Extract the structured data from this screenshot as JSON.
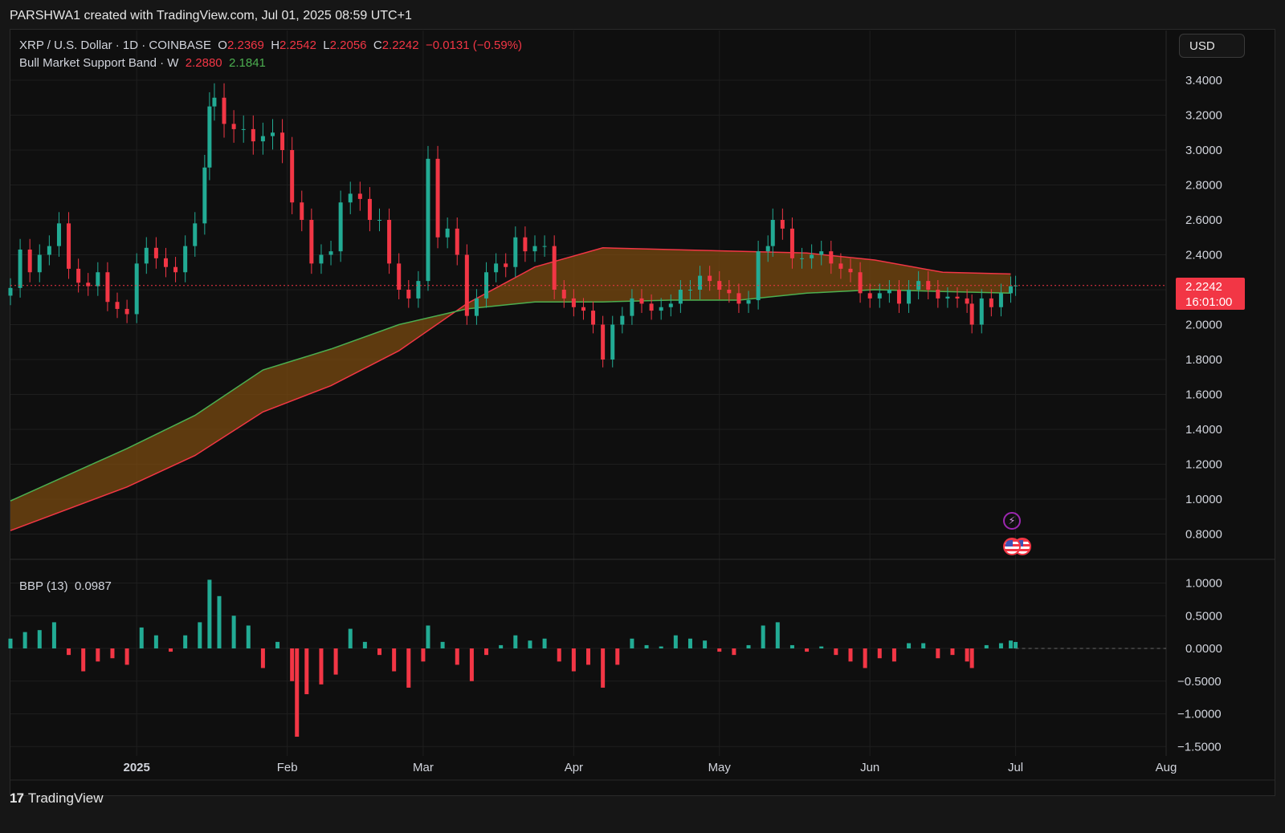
{
  "header": {
    "credit": "PARSHWA1 created with TradingView.com, Jul 01, 2025 08:59 UTC+1"
  },
  "legend": {
    "symbol": "XRP / U.S. Dollar · 1D · COINBASE",
    "o_label": "O",
    "o_value": "2.2369",
    "h_label": "H",
    "h_value": "2.2542",
    "l_label": "L",
    "l_value": "2.2056",
    "c_label": "C",
    "c_value": "2.2242",
    "change": "−0.0131 (−0.59%)",
    "band_name": "Bull Market Support Band · W",
    "band_upper": "2.2880",
    "band_lower": "2.1841"
  },
  "bbp_legend": {
    "name": "BBP (13)",
    "value": "0.0987"
  },
  "currency_button": "USD",
  "price_tag": {
    "price": "2.2242",
    "countdown": "16:01:00"
  },
  "footer": {
    "brand": "TradingView"
  },
  "colors": {
    "up": "#22ab94",
    "down": "#f23645",
    "band_fill": "#7a4a10",
    "sma": "#f23645",
    "ema": "#4caf50",
    "background": "#0f0f0f"
  },
  "chart_data": [
    {
      "type": "candlestick",
      "title": "XRP / U.S. Dollar · 1D · COINBASE",
      "x_tick_labels": [
        "2025",
        "Feb",
        "Mar",
        "Apr",
        "May",
        "Jun",
        "Jul",
        "Aug"
      ],
      "x_ticks": [
        "2025-01-01",
        "2025-02-01",
        "2025-03-01",
        "2025-04-01",
        "2025-05-01",
        "2025-06-01",
        "2025-07-01",
        "2025-08-01"
      ],
      "x_range": [
        "2024-12-06",
        "2025-08-01"
      ],
      "y_ticks": [
        3.4,
        3.2,
        3.0,
        2.8,
        2.6,
        2.4,
        2.2,
        2.0,
        1.8,
        1.6,
        1.4,
        1.2,
        1.0,
        0.8
      ],
      "y_tick_labels": [
        "3.4000",
        "3.2000",
        "3.0000",
        "2.8000",
        "2.6000",
        "2.4000",
        "2.2000",
        "2.0000",
        "1.8000",
        "1.6000",
        "1.4000",
        "1.2000",
        "1.0000",
        "0.8000"
      ],
      "ylim": [
        0.7,
        3.55
      ],
      "last_price": 2.2242,
      "daily_close": [
        [
          "2024-12-06",
          2.21
        ],
        [
          "2024-12-08",
          2.43
        ],
        [
          "2024-12-10",
          2.3
        ],
        [
          "2024-12-12",
          2.4
        ],
        [
          "2024-12-14",
          2.45
        ],
        [
          "2024-12-16",
          2.58
        ],
        [
          "2024-12-18",
          2.32
        ],
        [
          "2024-12-20",
          2.24
        ],
        [
          "2024-12-22",
          2.22
        ],
        [
          "2024-12-24",
          2.3
        ],
        [
          "2024-12-26",
          2.13
        ],
        [
          "2024-12-28",
          2.09
        ],
        [
          "2024-12-30",
          2.06
        ],
        [
          "2025-01-01",
          2.35
        ],
        [
          "2025-01-03",
          2.44
        ],
        [
          "2025-01-05",
          2.38
        ],
        [
          "2025-01-07",
          2.33
        ],
        [
          "2025-01-09",
          2.3
        ],
        [
          "2025-01-11",
          2.45
        ],
        [
          "2025-01-13",
          2.58
        ],
        [
          "2025-01-15",
          2.9
        ],
        [
          "2025-01-16",
          3.25
        ],
        [
          "2025-01-17",
          3.3
        ],
        [
          "2025-01-19",
          3.15
        ],
        [
          "2025-01-21",
          3.12
        ],
        [
          "2025-01-23",
          3.12
        ],
        [
          "2025-01-25",
          3.05
        ],
        [
          "2025-01-27",
          3.08
        ],
        [
          "2025-01-29",
          3.1
        ],
        [
          "2025-01-31",
          3.0
        ],
        [
          "2025-02-02",
          2.7
        ],
        [
          "2025-02-04",
          2.6
        ],
        [
          "2025-02-06",
          2.35
        ],
        [
          "2025-02-08",
          2.4
        ],
        [
          "2025-02-10",
          2.42
        ],
        [
          "2025-02-12",
          2.7
        ],
        [
          "2025-02-14",
          2.75
        ],
        [
          "2025-02-16",
          2.72
        ],
        [
          "2025-02-18",
          2.6
        ],
        [
          "2025-02-20",
          2.6
        ],
        [
          "2025-02-22",
          2.35
        ],
        [
          "2025-02-24",
          2.2
        ],
        [
          "2025-02-26",
          2.15
        ],
        [
          "2025-02-28",
          2.25
        ],
        [
          "2025-03-02",
          2.95
        ],
        [
          "2025-03-04",
          2.5
        ],
        [
          "2025-03-06",
          2.55
        ],
        [
          "2025-03-08",
          2.4
        ],
        [
          "2025-03-10",
          2.05
        ],
        [
          "2025-03-12",
          2.15
        ],
        [
          "2025-03-14",
          2.3
        ],
        [
          "2025-03-16",
          2.35
        ],
        [
          "2025-03-18",
          2.33
        ],
        [
          "2025-03-20",
          2.5
        ],
        [
          "2025-03-22",
          2.42
        ],
        [
          "2025-03-24",
          2.45
        ],
        [
          "2025-03-26",
          2.45
        ],
        [
          "2025-03-28",
          2.2
        ],
        [
          "2025-03-30",
          2.15
        ],
        [
          "2025-04-01",
          2.1
        ],
        [
          "2025-04-03",
          2.08
        ],
        [
          "2025-04-05",
          2.0
        ],
        [
          "2025-04-07",
          1.8
        ],
        [
          "2025-04-09",
          2.0
        ],
        [
          "2025-04-11",
          2.05
        ],
        [
          "2025-04-13",
          2.15
        ],
        [
          "2025-04-15",
          2.12
        ],
        [
          "2025-04-17",
          2.08
        ],
        [
          "2025-04-19",
          2.1
        ],
        [
          "2025-04-21",
          2.12
        ],
        [
          "2025-04-23",
          2.2
        ],
        [
          "2025-04-25",
          2.2
        ],
        [
          "2025-04-27",
          2.28
        ],
        [
          "2025-04-29",
          2.25
        ],
        [
          "2025-05-01",
          2.2
        ],
        [
          "2025-05-03",
          2.18
        ],
        [
          "2025-05-05",
          2.12
        ],
        [
          "2025-05-07",
          2.14
        ],
        [
          "2025-05-09",
          2.42
        ],
        [
          "2025-05-11",
          2.45
        ],
        [
          "2025-05-12",
          2.6
        ],
        [
          "2025-05-14",
          2.55
        ],
        [
          "2025-05-16",
          2.38
        ],
        [
          "2025-05-18",
          2.38
        ],
        [
          "2025-05-20",
          2.4
        ],
        [
          "2025-05-22",
          2.42
        ],
        [
          "2025-05-24",
          2.35
        ],
        [
          "2025-05-26",
          2.32
        ],
        [
          "2025-05-28",
          2.3
        ],
        [
          "2025-05-30",
          2.18
        ],
        [
          "2025-06-01",
          2.15
        ],
        [
          "2025-06-03",
          2.18
        ],
        [
          "2025-06-05",
          2.2
        ],
        [
          "2025-06-07",
          2.12
        ],
        [
          "2025-06-09",
          2.2
        ],
        [
          "2025-06-11",
          2.25
        ],
        [
          "2025-06-13",
          2.2
        ],
        [
          "2025-06-15",
          2.15
        ],
        [
          "2025-06-17",
          2.16
        ],
        [
          "2025-06-19",
          2.15
        ],
        [
          "2025-06-21",
          2.12
        ],
        [
          "2025-06-22",
          2.0
        ],
        [
          "2025-06-24",
          2.15
        ],
        [
          "2025-06-26",
          2.1
        ],
        [
          "2025-06-28",
          2.18
        ],
        [
          "2025-06-30",
          2.22
        ],
        [
          "2025-07-01",
          2.2242
        ]
      ],
      "series": [
        {
          "name": "Bull Market Support Band · W upper",
          "last_value": 2.288,
          "points": [
            [
              "2024-12-06",
              0.82
            ],
            [
              "2024-12-30",
              1.07
            ],
            [
              "2025-01-13",
              1.25
            ],
            [
              "2025-01-27",
              1.5
            ],
            [
              "2025-02-10",
              1.65
            ],
            [
              "2025-02-24",
              1.85
            ],
            [
              "2025-03-10",
              2.12
            ],
            [
              "2025-03-24",
              2.33
            ],
            [
              "2025-04-07",
              2.44
            ],
            [
              "2025-04-21",
              2.43
            ],
            [
              "2025-05-05",
              2.42
            ],
            [
              "2025-05-19",
              2.41
            ],
            [
              "2025-06-02",
              2.37
            ],
            [
              "2025-06-16",
              2.3
            ],
            [
              "2025-06-30",
              2.29
            ]
          ]
        },
        {
          "name": "Bull Market Support Band · W lower",
          "last_value": 2.1841,
          "points": [
            [
              "2024-12-06",
              0.99
            ],
            [
              "2024-12-30",
              1.29
            ],
            [
              "2025-01-13",
              1.48
            ],
            [
              "2025-01-27",
              1.74
            ],
            [
              "2025-02-10",
              1.86
            ],
            [
              "2025-02-24",
              2.0
            ],
            [
              "2025-03-10",
              2.09
            ],
            [
              "2025-03-24",
              2.13
            ],
            [
              "2025-04-07",
              2.13
            ],
            [
              "2025-04-21",
              2.14
            ],
            [
              "2025-05-05",
              2.14
            ],
            [
              "2025-05-19",
              2.18
            ],
            [
              "2025-06-02",
              2.2
            ],
            [
              "2025-06-16",
              2.19
            ],
            [
              "2025-06-30",
              2.18
            ]
          ]
        }
      ]
    },
    {
      "type": "bar",
      "title": "BBP (13)",
      "last_value": 0.0987,
      "y_ticks": [
        1.0,
        0.5,
        0.0,
        -0.5,
        -1.0,
        -1.5
      ],
      "y_tick_labels": [
        "1.0000",
        "0.5000",
        "0.0000",
        "−0.5000",
        "−1.0000",
        "−1.5000"
      ],
      "ylim": [
        -1.6,
        1.15
      ],
      "values": [
        [
          "2024-12-06",
          0.15
        ],
        [
          "2024-12-09",
          0.25
        ],
        [
          "2024-12-12",
          0.28
        ],
        [
          "2024-12-15",
          0.4
        ],
        [
          "2024-12-18",
          -0.1
        ],
        [
          "2024-12-21",
          -0.35
        ],
        [
          "2024-12-24",
          -0.2
        ],
        [
          "2024-12-27",
          -0.15
        ],
        [
          "2024-12-30",
          -0.25
        ],
        [
          "2025-01-02",
          0.32
        ],
        [
          "2025-01-05",
          0.2
        ],
        [
          "2025-01-08",
          -0.05
        ],
        [
          "2025-01-11",
          0.2
        ],
        [
          "2025-01-14",
          0.4
        ],
        [
          "2025-01-16",
          1.05
        ],
        [
          "2025-01-18",
          0.8
        ],
        [
          "2025-01-21",
          0.5
        ],
        [
          "2025-01-24",
          0.35
        ],
        [
          "2025-01-27",
          -0.3
        ],
        [
          "2025-01-30",
          0.1
        ],
        [
          "2025-02-02",
          -0.5
        ],
        [
          "2025-02-03",
          -1.35
        ],
        [
          "2025-02-05",
          -0.7
        ],
        [
          "2025-02-08",
          -0.55
        ],
        [
          "2025-02-11",
          -0.4
        ],
        [
          "2025-02-14",
          0.3
        ],
        [
          "2025-02-17",
          0.1
        ],
        [
          "2025-02-20",
          -0.1
        ],
        [
          "2025-02-23",
          -0.35
        ],
        [
          "2025-02-26",
          -0.6
        ],
        [
          "2025-03-01",
          -0.2
        ],
        [
          "2025-03-02",
          0.35
        ],
        [
          "2025-03-05",
          0.1
        ],
        [
          "2025-03-08",
          -0.25
        ],
        [
          "2025-03-11",
          -0.5
        ],
        [
          "2025-03-14",
          -0.1
        ],
        [
          "2025-03-17",
          0.05
        ],
        [
          "2025-03-20",
          0.2
        ],
        [
          "2025-03-23",
          0.12
        ],
        [
          "2025-03-26",
          0.15
        ],
        [
          "2025-03-29",
          -0.2
        ],
        [
          "2025-04-01",
          -0.35
        ],
        [
          "2025-04-04",
          -0.25
        ],
        [
          "2025-04-07",
          -0.6
        ],
        [
          "2025-04-10",
          -0.25
        ],
        [
          "2025-04-13",
          0.15
        ],
        [
          "2025-04-16",
          0.05
        ],
        [
          "2025-04-19",
          0.03
        ],
        [
          "2025-04-22",
          0.2
        ],
        [
          "2025-04-25",
          0.15
        ],
        [
          "2025-04-28",
          0.12
        ],
        [
          "2025-05-01",
          -0.05
        ],
        [
          "2025-05-04",
          -0.1
        ],
        [
          "2025-05-07",
          0.05
        ],
        [
          "2025-05-10",
          0.35
        ],
        [
          "2025-05-13",
          0.4
        ],
        [
          "2025-05-16",
          0.05
        ],
        [
          "2025-05-19",
          -0.05
        ],
        [
          "2025-05-22",
          0.03
        ],
        [
          "2025-05-25",
          -0.1
        ],
        [
          "2025-05-28",
          -0.2
        ],
        [
          "2025-05-31",
          -0.3
        ],
        [
          "2025-06-03",
          -0.15
        ],
        [
          "2025-06-06",
          -0.2
        ],
        [
          "2025-06-09",
          0.08
        ],
        [
          "2025-06-12",
          0.08
        ],
        [
          "2025-06-15",
          -0.15
        ],
        [
          "2025-06-18",
          -0.1
        ],
        [
          "2025-06-21",
          -0.2
        ],
        [
          "2025-06-22",
          -0.3
        ],
        [
          "2025-06-25",
          0.05
        ],
        [
          "2025-06-28",
          0.08
        ],
        [
          "2025-06-30",
          0.12
        ],
        [
          "2025-07-01",
          0.0987
        ]
      ]
    }
  ]
}
